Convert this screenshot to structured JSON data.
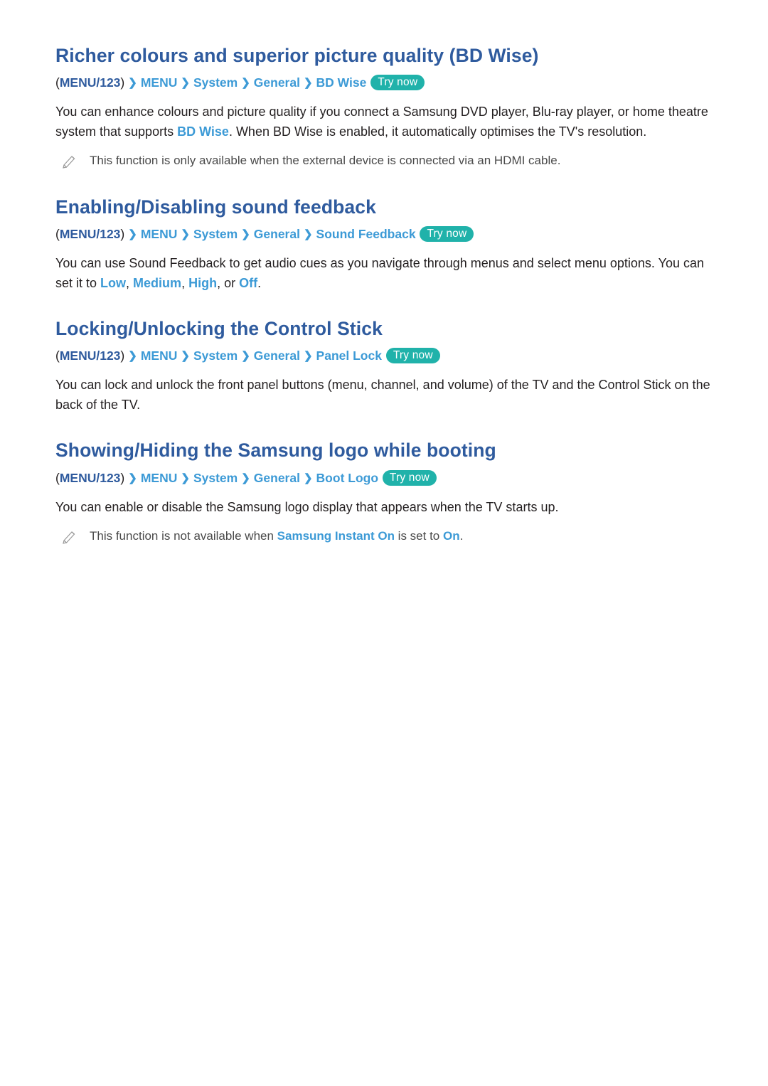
{
  "sections": [
    {
      "title": "Richer colours and superior picture quality (BD Wise)",
      "breadcrumb": {
        "open_paren": "(",
        "menu123": "MENU/123",
        "close_paren": ")",
        "crumbs": [
          "MENU",
          "System",
          "General",
          "BD Wise"
        ],
        "try_now": "Try now"
      },
      "body_parts": [
        {
          "text": "You can enhance colours and picture quality if you connect a Samsung DVD player, Blu-ray player, or home theatre system that supports ",
          "style": "normal"
        },
        {
          "text": "BD Wise",
          "style": "blue"
        },
        {
          "text": ". When BD Wise is enabled, it automatically optimises the TV's resolution.",
          "style": "normal"
        }
      ],
      "note": [
        {
          "text": "This function is only available when the external device is connected via an HDMI cable.",
          "style": "normal"
        }
      ]
    },
    {
      "title": "Enabling/Disabling sound feedback",
      "breadcrumb": {
        "open_paren": "(",
        "menu123": "MENU/123",
        "close_paren": ")",
        "crumbs": [
          "MENU",
          "System",
          "General",
          "Sound Feedback"
        ],
        "try_now": "Try now"
      },
      "body_parts": [
        {
          "text": "You can use Sound Feedback to get audio cues as you navigate through menus and select menu options. You can set it to ",
          "style": "normal"
        },
        {
          "text": "Low",
          "style": "blue"
        },
        {
          "text": ", ",
          "style": "normal"
        },
        {
          "text": "Medium",
          "style": "blue"
        },
        {
          "text": ", ",
          "style": "normal"
        },
        {
          "text": "High",
          "style": "blue"
        },
        {
          "text": ", or ",
          "style": "normal"
        },
        {
          "text": "Off",
          "style": "blue"
        },
        {
          "text": ".",
          "style": "normal"
        }
      ],
      "note": []
    },
    {
      "title": "Locking/Unlocking the Control Stick",
      "breadcrumb": {
        "open_paren": "(",
        "menu123": "MENU/123",
        "close_paren": ")",
        "crumbs": [
          "MENU",
          "System",
          "General",
          "Panel Lock"
        ],
        "try_now": "Try now"
      },
      "body_parts": [
        {
          "text": "You can lock and unlock the front panel buttons (menu, channel, and volume) of the TV and the Control Stick on the back of the TV.",
          "style": "normal"
        }
      ],
      "note": []
    },
    {
      "title": "Showing/Hiding the Samsung logo while booting",
      "breadcrumb": {
        "open_paren": "(",
        "menu123": "MENU/123",
        "close_paren": ")",
        "crumbs": [
          "MENU",
          "System",
          "General",
          "Boot Logo"
        ],
        "try_now": "Try now"
      },
      "body_parts": [
        {
          "text": "You can enable or disable the Samsung logo display that appears when the TV starts up.",
          "style": "normal"
        }
      ],
      "note": [
        {
          "text": "This function is not available when ",
          "style": "normal"
        },
        {
          "text": "Samsung Instant On",
          "style": "blue"
        },
        {
          "text": " is set to ",
          "style": "normal"
        },
        {
          "text": "On",
          "style": "blue"
        },
        {
          "text": ".",
          "style": "normal"
        }
      ]
    }
  ],
  "colors": {
    "heading": "#2f5b9e",
    "link": "#3c9ad6",
    "try_now_bg": "#20b2aa",
    "body": "#231f20"
  }
}
